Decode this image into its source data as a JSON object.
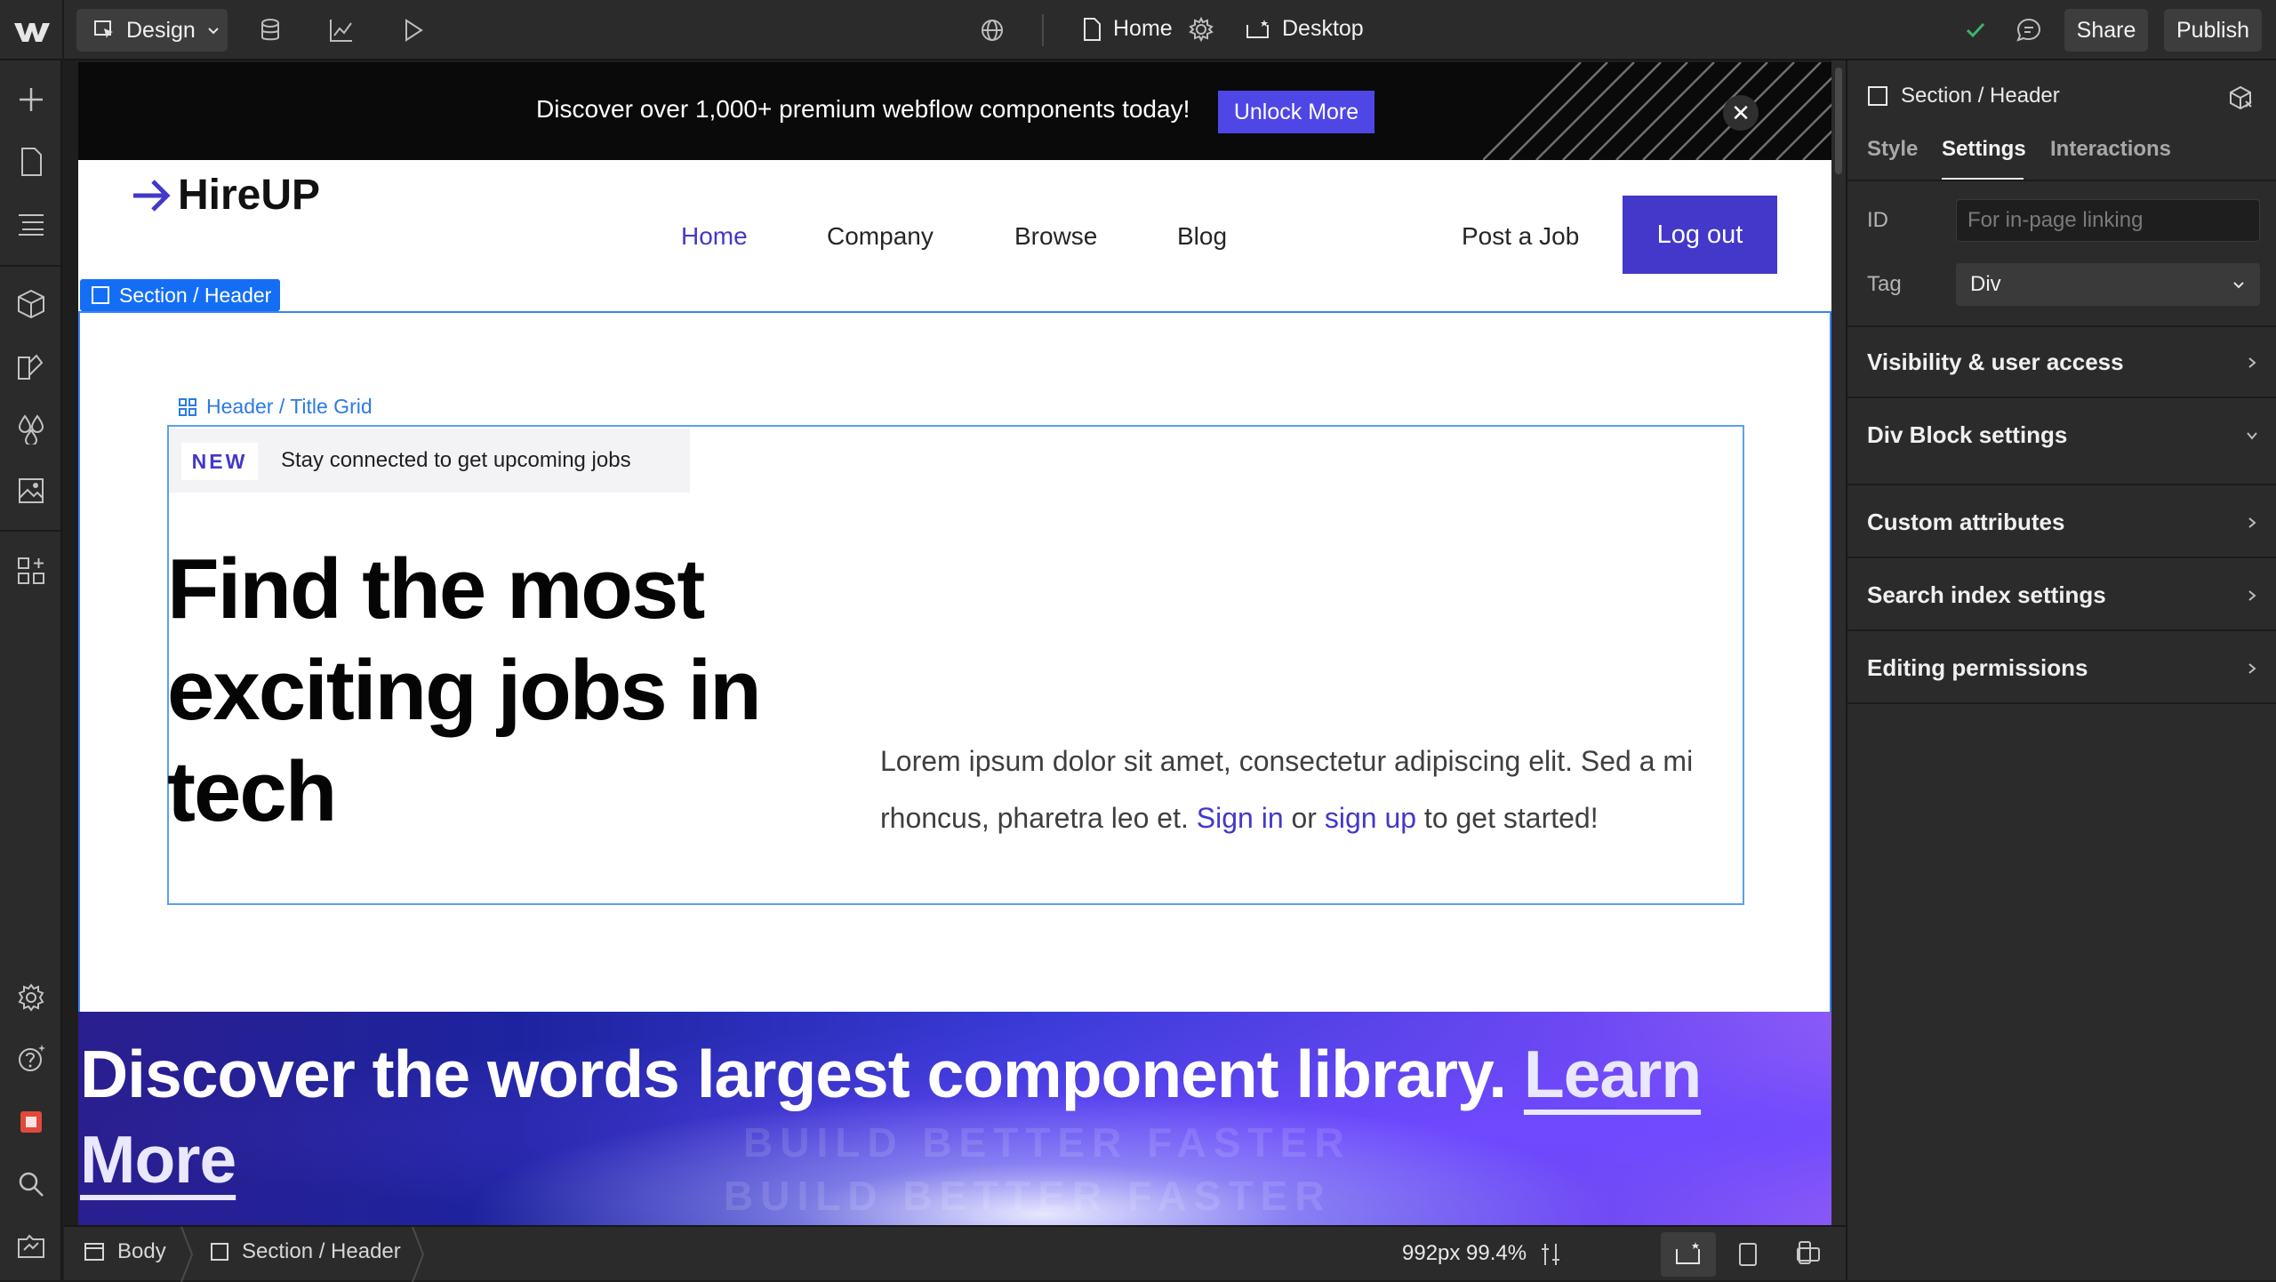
{
  "topbar": {
    "mode_label": "Design",
    "page_label": "Home",
    "breakpoint_label": "Desktop",
    "share_label": "Share",
    "publish_label": "Publish"
  },
  "promo": {
    "text": "Discover over 1,000+ premium webflow components today!",
    "button_label": "Unlock More",
    "close_symbol": "✕"
  },
  "site": {
    "brand": "HireUP",
    "nav": [
      "Home",
      "Company",
      "Browse",
      "Blog"
    ],
    "post_job": "Post a Job",
    "logout": "Log out",
    "badge": "NEW",
    "badge_text": "Stay connected to get upcoming jobs",
    "hero_title_lines": [
      "Find the most",
      "exciting jobs in",
      "tech"
    ],
    "hero_copy_line1": "Lorem ipsum dolor sit amet, consectetur adipiscing elit. Sed a mi",
    "hero_copy_line2_pre": "rhoncus, pharetra leo et. ",
    "hero_copy_signin": "Sign in",
    "hero_copy_or": " or ",
    "hero_copy_signup": "sign up",
    "hero_copy_end": " to get started!",
    "banner_text": "Discover the words largest component library. ",
    "banner_link_1": "Learn",
    "banner_link_2": "More",
    "banner_ghost_1": "BUILD BETTER FASTER",
    "banner_ghost_2": "BUILD BETTER FASTER"
  },
  "selection": {
    "section_tag": "Section / Header",
    "title_grid_label": "Header / Title Grid"
  },
  "statusbar": {
    "crumbs": [
      "Body",
      "Section / Header"
    ],
    "readout": "992px 99.4%"
  },
  "rightpanel": {
    "header": "Section / Header",
    "tabs": [
      "Style",
      "Settings",
      "Interactions"
    ],
    "active_tab": "Settings",
    "id_label": "ID",
    "id_placeholder": "For in-page linking",
    "tag_label": "Tag",
    "tag_value": "Div",
    "sections": [
      "Visibility & user access",
      "Div Block settings",
      "Custom attributes",
      "Search index settings",
      "Editing permissions"
    ]
  },
  "colors": {
    "accent": "#4338ca",
    "selection_blue": "#146ef5",
    "success_check": "#3fb26b"
  },
  "icons": [
    "webflow-logo",
    "add-icon",
    "pages-icon",
    "navigator-icon",
    "components-icon",
    "variables-icon",
    "styles-icon",
    "assets-icon",
    "apps-icon",
    "settings-icon",
    "help-icon",
    "record-icon",
    "search-icon",
    "marketplace-icon",
    "cms-icon",
    "analyze-icon",
    "preview-icon",
    "globe-icon",
    "page-icon",
    "gear-icon",
    "desktop-icon",
    "check-icon",
    "comment-icon",
    "cube-icon",
    "chevron-down-icon",
    "chevron-right-icon",
    "tablet-icon",
    "mobile-landscape-icon",
    "mobile-portrait-icon",
    "resize-icon"
  ]
}
